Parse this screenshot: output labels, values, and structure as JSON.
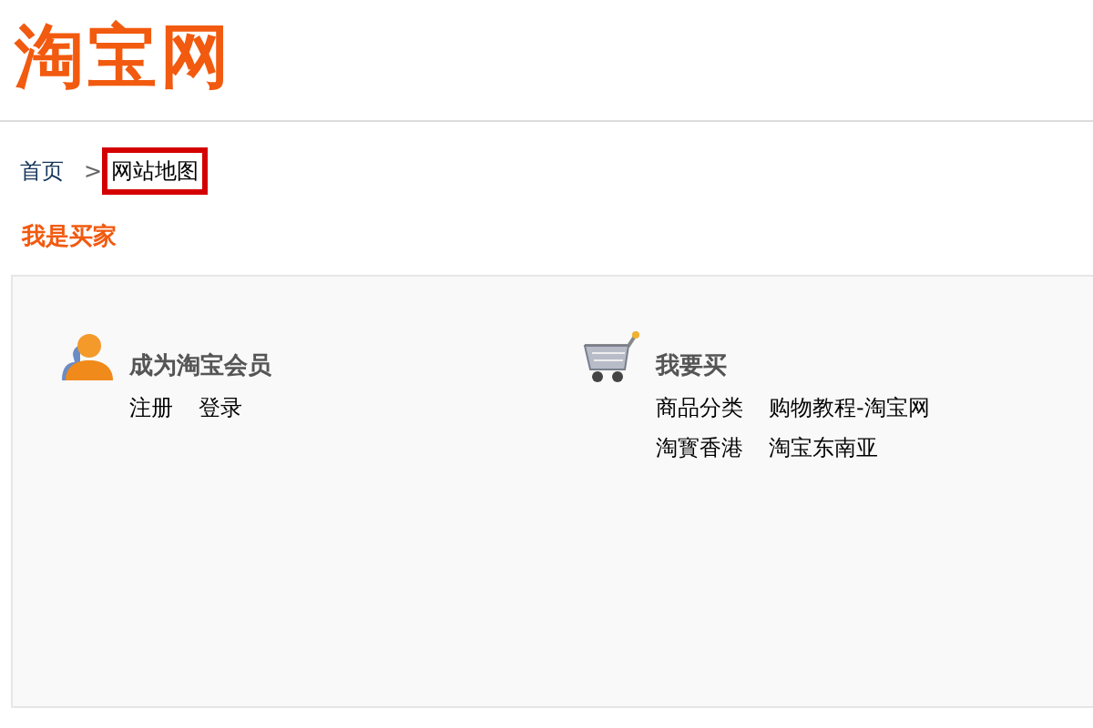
{
  "logo": {
    "text": "淘宝网"
  },
  "breadcrumb": [
    {
      "label": "首页",
      "highlighted": false
    },
    {
      "label": "网站地图",
      "highlighted": true
    }
  ],
  "breadcrumb_separator": ">",
  "section": {
    "title": "我是买家",
    "groups": [
      {
        "kind": "member",
        "title": "成为淘宝会员",
        "link_rows": [
          [
            "注册",
            "登录"
          ]
        ]
      },
      {
        "kind": "cart",
        "title": "我要买",
        "link_rows": [
          [
            "商品分类",
            "购物教程-淘宝网"
          ],
          [
            "淘寳香港",
            "淘宝东南亚"
          ]
        ]
      }
    ]
  }
}
